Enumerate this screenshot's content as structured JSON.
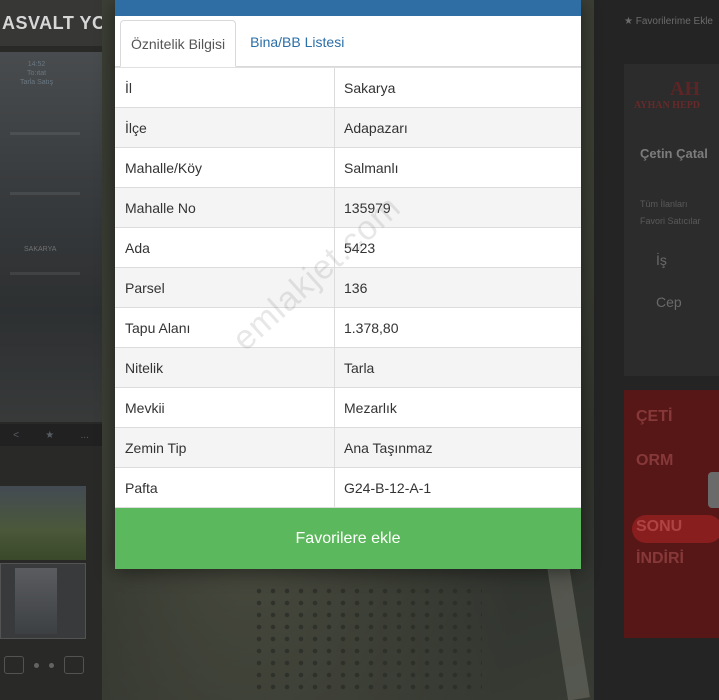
{
  "background": {
    "left_title": "ASVALT YOL",
    "left_photo_caption": "14:52\nTo:ıtat\nTarla Satış",
    "left_sign_text": "SAKARYA",
    "left_nav": {
      "prev": "<",
      "star": "★",
      "more": "..."
    },
    "right_favorites_link": "Favorilerime Ekle",
    "right_logo_mark": "AH",
    "right_logo_text": "AYHAN HEPD",
    "right_agent_name": "Çetin Çatal",
    "right_links": [
      "Tüm İlanları",
      "Favori Satıcılar"
    ],
    "right_is_label": "İş",
    "right_cep_label": "Cep",
    "ad_lines": [
      "ÇETİ",
      "ORM",
      "SONU",
      "İNDİRİ"
    ]
  },
  "modal": {
    "tabs": [
      {
        "label": "Öznitelik Bilgisi",
        "active": true
      },
      {
        "label": "Bina/BB Listesi",
        "active": false
      }
    ],
    "rows": [
      {
        "label": "İl",
        "value": "Sakarya"
      },
      {
        "label": "İlçe",
        "value": "Adapazarı"
      },
      {
        "label": "Mahalle/Köy",
        "value": "Salmanlı"
      },
      {
        "label": "Mahalle No",
        "value": "135979"
      },
      {
        "label": "Ada",
        "value": "5423"
      },
      {
        "label": "Parsel",
        "value": "136"
      },
      {
        "label": "Tapu Alanı",
        "value": "1.378,80"
      },
      {
        "label": "Nitelik",
        "value": "Tarla"
      },
      {
        "label": "Mevkii",
        "value": "Mezarlık"
      },
      {
        "label": "Zemin Tip",
        "value": "Ana Taşınmaz"
      },
      {
        "label": "Pafta",
        "value": "G24-B-12-A-1"
      }
    ],
    "favorite_button_label": "Favorilere ekle",
    "watermark": "emlakjet.com"
  },
  "colors": {
    "modal_topbar": "#2f6ea5",
    "tab_link": "#2b6ea8",
    "favorite_button": "#5cb85c"
  }
}
